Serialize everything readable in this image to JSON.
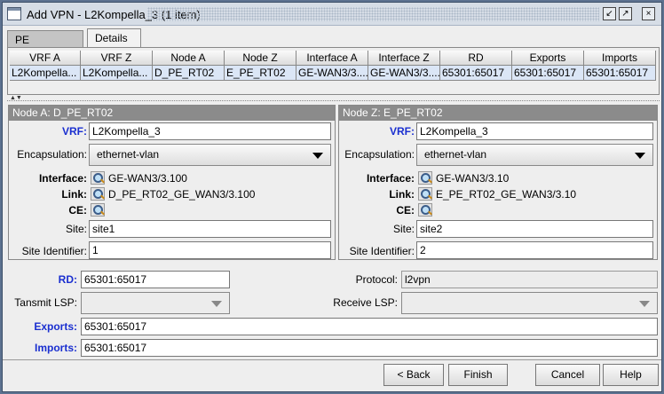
{
  "window": {
    "title": "Add VPN - L2Kompella_3 (1 item)"
  },
  "tabs": [
    {
      "label": "PE Selection"
    },
    {
      "label": "Details"
    }
  ],
  "table": {
    "headers": [
      "VRF A",
      "VRF Z",
      "Node A",
      "Node Z",
      "Interface A",
      "Interface Z",
      "RD",
      "Exports",
      "Imports"
    ],
    "rows": [
      [
        "L2Kompella...",
        "L2Kompella...",
        "D_PE_RT02",
        "E_PE_RT02",
        "GE-WAN3/3....",
        "GE-WAN3/3....",
        "65301:65017",
        "65301:65017",
        "65301:65017"
      ]
    ]
  },
  "node_a": {
    "title": "Node A: D_PE_RT02",
    "vrf_label": "VRF:",
    "vrf": "L2Kompella_3",
    "encap_label": "Encapsulation:",
    "encap": "ethernet-vlan",
    "interface_label": "Interface:",
    "interface": "GE-WAN3/3.100",
    "link_label": "Link:",
    "link": "D_PE_RT02_GE_WAN3/3.100",
    "ce_label": "CE:",
    "site_label": "Site:",
    "site": "site1",
    "site_id_label": "Site Identifier:",
    "site_id": "1"
  },
  "node_z": {
    "title": "Node Z: E_PE_RT02",
    "vrf_label": "VRF:",
    "vrf": "L2Kompella_3",
    "encap_label": "Encapsulation:",
    "encap": "ethernet-vlan",
    "interface_label": "Interface:",
    "interface": "GE-WAN3/3.10",
    "link_label": "Link:",
    "link": "E_PE_RT02_GE_WAN3/3.10",
    "ce_label": "CE:",
    "site_label": "Site:",
    "site": "site2",
    "site_id_label": "Site Identifier:",
    "site_id": "2"
  },
  "common": {
    "rd_label": "RD:",
    "rd": "65301:65017",
    "protocol_label": "Protocol:",
    "protocol": "l2vpn",
    "transmit_lsp_label": "Tansmit LSP:",
    "transmit_lsp": "",
    "receive_lsp_label": "Receive LSP:",
    "receive_lsp": "",
    "exports_label": "Exports:",
    "exports": "65301:65017",
    "imports_label": "Imports:",
    "imports": "65301:65017"
  },
  "buttons": {
    "back": "< Back",
    "finish": "Finish",
    "cancel": "Cancel",
    "help": "Help"
  },
  "colors": {
    "required_label": "#1a2fd0",
    "selection": "#dbe6f6",
    "panel_title": "#8b8b8b"
  }
}
